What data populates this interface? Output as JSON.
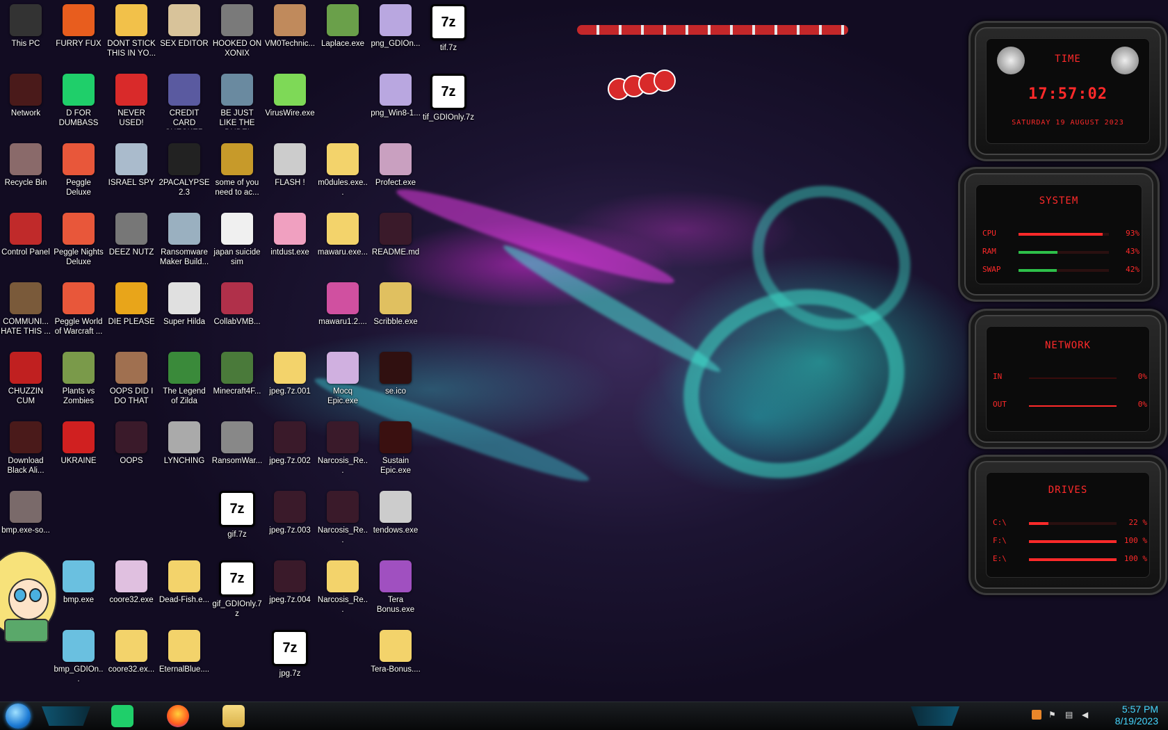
{
  "desktop_icons": [
    {
      "label": "This PC",
      "color": "#333"
    },
    {
      "label": "FURRY FUX",
      "color": "#e85d1e"
    },
    {
      "label": "DONT STICK THIS IN YO...",
      "color": "#f2c14a"
    },
    {
      "label": "SEX EDITOR",
      "color": "#d8c39a"
    },
    {
      "label": "HOOKED ON XONIX",
      "color": "#7a7a7a"
    },
    {
      "label": "VM0Technic...",
      "color": "#c08a5c"
    },
    {
      "label": "Laplace.exe",
      "color": "#6aa04a"
    },
    {
      "label": "png_GDIOn...",
      "color": "#b9a7e0"
    },
    {
      "label": "tif.7z",
      "color": "#ffffff"
    },
    {
      "label": "Network",
      "color": "#4a1a1a"
    },
    {
      "label": "D FOR DUMBASS",
      "color": "#1fcf6a"
    },
    {
      "label": "NEVER USED!",
      "color": "#d92a2a"
    },
    {
      "label": "CREDIT CARD CHECKER",
      "color": "#5a5aa0"
    },
    {
      "label": "BE JUST LIKE THE DUDE!",
      "color": "#6a8aa0"
    },
    {
      "label": "VirusWire.exe",
      "color": "#7ed957"
    },
    {
      "label": "png_Win8-1...",
      "color": "#b9a7e0"
    },
    {
      "label": "tif_GDIOnly.7z",
      "color": "#ffffff"
    },
    {
      "label": "Recycle Bin",
      "color": "#8a6a6a"
    },
    {
      "label": "Peggle Deluxe",
      "color": "#e8573a"
    },
    {
      "label": "ISRAEL SPY",
      "color": "#aabbcc"
    },
    {
      "label": "2PACALYPSE 2.3",
      "color": "#222"
    },
    {
      "label": "some of you need to ac...",
      "color": "#c79a2a"
    },
    {
      "label": "FLASH !",
      "color": "#cccccc"
    },
    {
      "label": "m0dules.exe...",
      "color": "#f3d36b"
    },
    {
      "label": "Profect.exe",
      "color": "#c9a0c0"
    },
    {
      "label": "Control Panel",
      "color": "#c02a2a"
    },
    {
      "label": "Peggle Nights Deluxe",
      "color": "#e8573a"
    },
    {
      "label": "DEEZ NUTZ",
      "color": "#777"
    },
    {
      "label": "Ransomware Maker Build...",
      "color": "#9ab0c0"
    },
    {
      "label": "japan suicide sim",
      "color": "#f0f0f0"
    },
    {
      "label": "intdust.exe",
      "color": "#f0a0c0"
    },
    {
      "label": "mawaru.exe...",
      "color": "#f3d36b"
    },
    {
      "label": "README.md",
      "color": "#3a1a2a"
    },
    {
      "label": "COMMUNI... HATE THIS ...",
      "color": "#7a5a3a"
    },
    {
      "label": "Peggle World of Warcraft ...",
      "color": "#e8573a"
    },
    {
      "label": "DIE PLEASE",
      "color": "#e8a51a"
    },
    {
      "label": "Super Hilda",
      "color": "#e0e0e0"
    },
    {
      "label": "CollabVMB...",
      "color": "#b0304a"
    },
    {
      "label": "mawaru1.2....",
      "color": "#d050a0"
    },
    {
      "label": "Scribble.exe",
      "color": "#e0c060"
    },
    {
      "label": "CHUZZIN CUM",
      "color": "#c02020"
    },
    {
      "label": "Plants vs Zombies",
      "color": "#7a9a4a"
    },
    {
      "label": "OOPS DID I DO THAT",
      "color": "#a07050"
    },
    {
      "label": "The Legend of Zilda",
      "color": "#3a8a3a"
    },
    {
      "label": "Minecraft4F...",
      "color": "#4a7a3a"
    },
    {
      "label": "jpeg.7z.001",
      "color": "#f3d36b"
    },
    {
      "label": "Mocq Epic.exe",
      "color": "#d0b0e0"
    },
    {
      "label": "se.ico",
      "color": "#301010"
    },
    {
      "label": "Download Black Ali...",
      "color": "#4a1a1a"
    },
    {
      "label": "UKRAINE",
      "color": "#d02020"
    },
    {
      "label": "OOPS",
      "color": "#3a1a2a"
    },
    {
      "label": "LYNCHING",
      "color": "#aaaaaa"
    },
    {
      "label": "RansomWar...",
      "color": "#888"
    },
    {
      "label": "jpeg.7z.002",
      "color": "#3a1a2a"
    },
    {
      "label": "Narcosis_Re...",
      "color": "#3a1a2a"
    },
    {
      "label": "Sustain Epic.exe",
      "color": "#3a1010"
    },
    {
      "label": "bmp.exe-so...",
      "color": "#7a6a6a"
    },
    {
      "label": "gif.7z",
      "color": "#ffffff"
    },
    {
      "label": "jpeg.7z.003",
      "color": "#3a1a2a"
    },
    {
      "label": "Narcosis_Re...",
      "color": "#3a1a2a"
    },
    {
      "label": "tendows.exe",
      "color": "#cccccc"
    },
    {
      "label": "bmp.exe",
      "color": "#6ac0e0"
    },
    {
      "label": "coore32.exe",
      "color": "#e0c0e0"
    },
    {
      "label": "Dead-Fish.e...",
      "color": "#f3d36b"
    },
    {
      "label": "gif_GDIOnly.7z",
      "color": "#ffffff"
    },
    {
      "label": "jpeg.7z.004",
      "color": "#3a1a2a"
    },
    {
      "label": "Narcosis_Re...",
      "color": "#f3d36b"
    },
    {
      "label": "Tera Bonus.exe",
      "color": "#a050c0"
    },
    {
      "label": "bmp_GDIOn...",
      "color": "#6ac0e0"
    },
    {
      "label": "coore32.ex...",
      "color": "#f3d36b"
    },
    {
      "label": "EternalBlue....",
      "color": "#f3d36b"
    },
    {
      "label": "jpg.7z",
      "color": "#ffffff"
    },
    {
      "label": "Tera-Bonus....",
      "color": "#f3d36b"
    }
  ],
  "widgets": {
    "time": {
      "title": "TIME",
      "clock": "17:57:02",
      "date": "SATURDAY 19 AUGUST 2023"
    },
    "system": {
      "title": "SYSTEM",
      "rows": [
        {
          "key": "CPU",
          "value": "93%",
          "level": 0.93
        },
        {
          "key": "RAM",
          "value": "43%",
          "level": 0.43
        },
        {
          "key": "SWAP",
          "value": "42%",
          "level": 0.42
        }
      ]
    },
    "network": {
      "title": "NETWORK",
      "rows": [
        {
          "key": "IN",
          "value": "0%"
        },
        {
          "key": "OUT",
          "value": "0%"
        }
      ]
    },
    "drives": {
      "title": "DRIVES",
      "rows": [
        {
          "key": "C:\\",
          "value": "22 %",
          "level": 0.22
        },
        {
          "key": "F:\\",
          "value": "100 %",
          "level": 1.0
        },
        {
          "key": "E:\\",
          "value": "100 %",
          "level": 1.0
        }
      ]
    }
  },
  "taskbar": {
    "time": "5:57 PM",
    "date": "8/19/2023",
    "apps": [
      "start-orb",
      "notes-app",
      "firefox",
      "file-explorer"
    ]
  }
}
